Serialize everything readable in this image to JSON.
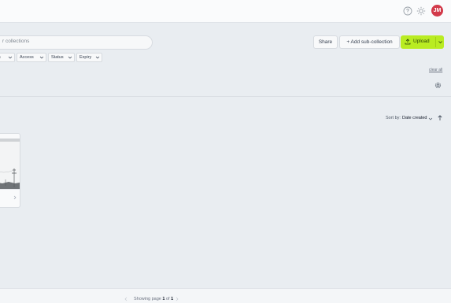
{
  "header": {
    "avatar_initials": "JM",
    "icons": [
      "help-icon",
      "sun-icon"
    ]
  },
  "search": {
    "placeholder": "r collections"
  },
  "toolbar": {
    "share_label": "Share",
    "add_sub_label": "+ Add sub-collection",
    "upload_label": "Upload",
    "upload_color": "#b9ec22"
  },
  "filters": [
    {
      "label": "s"
    },
    {
      "label": "Access"
    },
    {
      "label": "Status"
    },
    {
      "label": "Expiry"
    }
  ],
  "clear_label": "clear all",
  "sort": {
    "label": "Sort by:",
    "value": "Date created"
  },
  "pagination": {
    "prefix": "Showing page",
    "page": "1",
    "of_word": "of",
    "total": "1"
  },
  "colors": {
    "avatar": "#d23a4a",
    "background": "#e9edf1"
  }
}
